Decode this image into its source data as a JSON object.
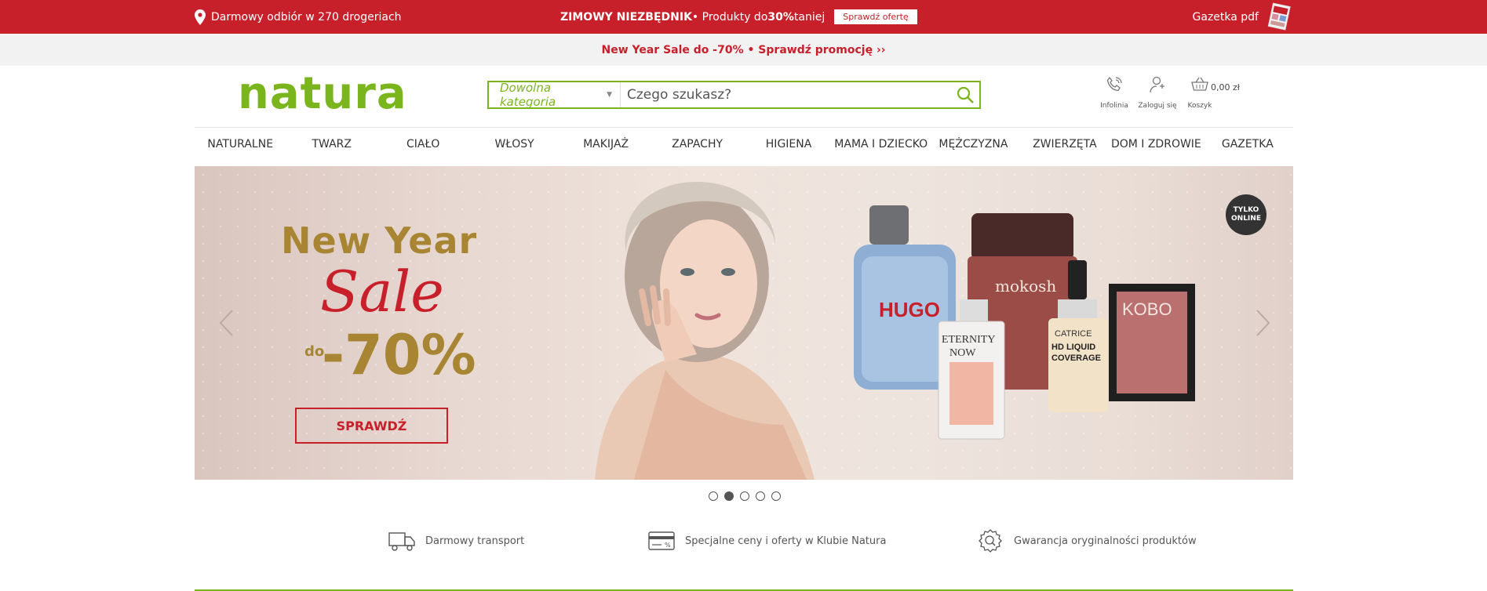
{
  "topbar": {
    "pickup_text": "Darmowy odbiór w 270 drogeriach",
    "promo_bold": "ZIMOWY NIEZBĘDNIK",
    "promo_mid": " • Produkty do ",
    "promo_pct": "30%",
    "promo_end": " taniej",
    "offer_button": "Sprawdź ofertę",
    "gazetka_link": "Gazetka pdf",
    "icons": {
      "pin": "location-pin-icon",
      "magazine": "magazine-thumbnail-icon"
    }
  },
  "promo_strip": {
    "text": "New Year Sale do -70% • Sprawdź promocję ››"
  },
  "header": {
    "logo": "natura",
    "search": {
      "category": "Dowolna kategoria",
      "placeholder": "Czego szukasz?"
    },
    "icons": [
      {
        "label": "Infolinia",
        "icon": "phone-icon"
      },
      {
        "label": "Zaloguj się",
        "icon": "user-icon"
      },
      {
        "label": "Koszyk",
        "icon": "basket-icon"
      }
    ],
    "cart_total": "0,00 zł"
  },
  "nav": [
    "NATURALNE",
    "TWARZ",
    "CIAŁO",
    "WŁOSY",
    "MAKIJAŻ",
    "ZAPACHY",
    "HIGIENA",
    "MAMA I DZIECKO",
    "MĘŻCZYZNA",
    "ZWIERZĘTA",
    "DOM I ZDROWIE",
    "GAZETKA"
  ],
  "banner": {
    "line1": "New Year",
    "line2": "Sale",
    "do": "do",
    "discount": "-70%",
    "button": "SPRAWDŹ",
    "badge_line1": "TYLKO",
    "badge_line2": "ONLINE",
    "products": {
      "hugo": "HUGO",
      "eternity_1": "ETERNITY",
      "eternity_2": "NOW",
      "mokosh": "mokosh",
      "catrice": "CATRICE",
      "hd_1": "HD LIQUID",
      "hd_2": "COVERAGE",
      "kobo": "KOBO"
    }
  },
  "carousel": {
    "slide_count": 5,
    "active_index": 1
  },
  "features": [
    {
      "label": "Darmowy transport",
      "icon": "truck-icon"
    },
    {
      "label": "Specjalne ceny i oferty w Klubie Natura",
      "icon": "card-icon"
    },
    {
      "label": "Gwarancja oryginalności produktów",
      "icon": "quality-seal-icon"
    }
  ],
  "colors": {
    "brand_red": "#c7202a",
    "brand_green": "#7ab51d",
    "gold": "#a88532"
  }
}
